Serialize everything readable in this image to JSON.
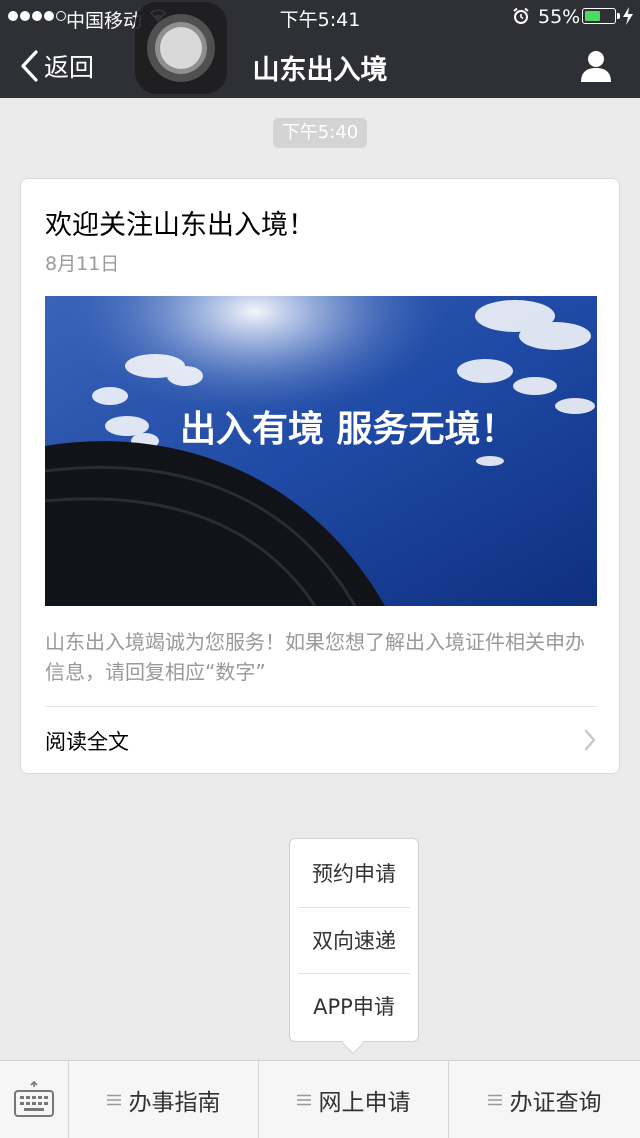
{
  "status_bar": {
    "carrier": "中国移动",
    "time": "下午5:41",
    "battery_text": "55%",
    "battery_level": 0.55,
    "battery_color": "#4cd964"
  },
  "nav": {
    "back_label": "返回",
    "title": "山东出入境",
    "profile_icon": "person-icon"
  },
  "chat": {
    "timestamp": "下午5:40"
  },
  "article": {
    "title": "欢迎关注山东出入境！",
    "date": "8月11日",
    "image_text": "出入有境 服务无境！",
    "description": "山东出入境竭诚为您服务！如果您想了解出入境证件相关申办信息，请回复相应“数字”",
    "read_more": "阅读全文"
  },
  "popup_menu": {
    "items": [
      "预约申请",
      "双向速递",
      "APP申请"
    ]
  },
  "bottom_menu": {
    "keyboard_icon": "keyboard-icon",
    "items": [
      "办事指南",
      "网上申请",
      "办证查询"
    ]
  },
  "colors": {
    "header_bg": "#2f3035",
    "page_bg": "#ebebeb"
  }
}
